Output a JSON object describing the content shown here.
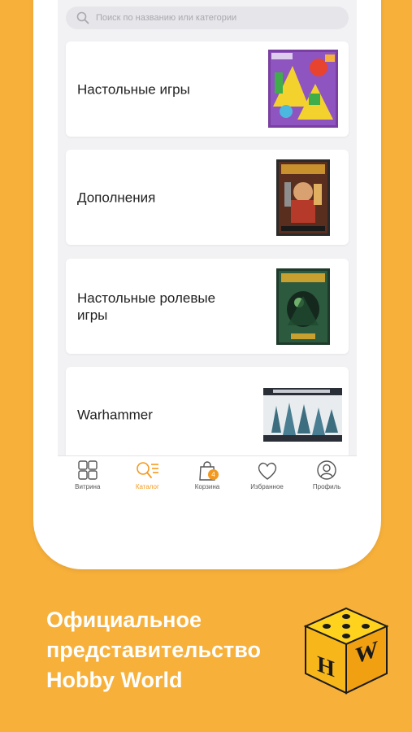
{
  "search": {
    "placeholder": "Поиск по названию или категории"
  },
  "categories": [
    {
      "label": "Настольные игры"
    },
    {
      "label": "Дополнения"
    },
    {
      "label": "Настольные ролевые игры"
    },
    {
      "label": "Warhammer"
    }
  ],
  "tabbar": {
    "items": [
      {
        "label": "Витрина",
        "icon": "grid-icon"
      },
      {
        "label": "Каталог",
        "icon": "catalog-search-icon",
        "active": true
      },
      {
        "label": "Корзина",
        "icon": "shopping-bag-icon",
        "badge": "4"
      },
      {
        "label": "Избранное",
        "icon": "heart-icon"
      },
      {
        "label": "Профиль",
        "icon": "profile-icon"
      }
    ]
  },
  "promo": {
    "line1": "Официальное",
    "line2": "представительство",
    "line3": "Hobby World"
  },
  "logo": {
    "letter_left": "H",
    "letter_right": "W"
  },
  "colors": {
    "background": "#F7B03A",
    "accent": "#F39A1E",
    "card": "#FFFFFF"
  }
}
